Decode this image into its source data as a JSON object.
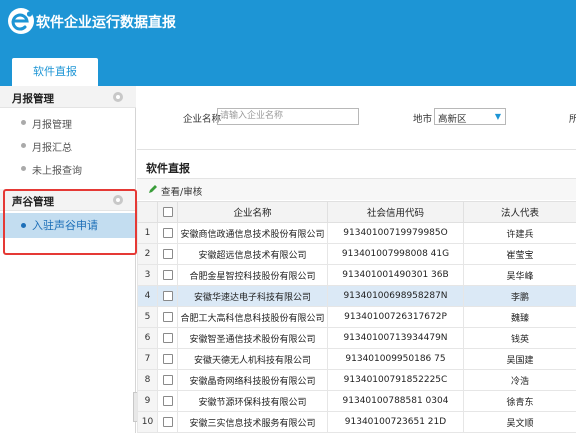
{
  "header": {
    "title": "软件企业运行数据直报",
    "logo_icon": "e-logo-icon"
  },
  "tabs": [
    {
      "label": "软件直报"
    }
  ],
  "sidebar": {
    "groups": [
      {
        "title": "月报管理",
        "items": [
          {
            "label": "月报管理"
          },
          {
            "label": "月报汇总"
          },
          {
            "label": "未上报查询"
          }
        ]
      },
      {
        "title": "声谷管理",
        "items": [
          {
            "label": "入驻声谷申请"
          }
        ]
      }
    ]
  },
  "search": {
    "company_label": "企业名称",
    "company_placeholder": "请输入企业名称",
    "region_label": "地市",
    "region_value": "高新区",
    "cut_label": "所"
  },
  "panel": {
    "title": "软件直报",
    "edit_label": "查看/审核"
  },
  "table": {
    "columns": [
      "企业名称",
      "社会信用代码",
      "法人代表"
    ],
    "rows": [
      {
        "num": "1",
        "name": "安徽商信政通信息技术股份有限公司",
        "code": "91340100719979985O",
        "rep": "许建兵"
      },
      {
        "num": "2",
        "name": "安徽超远信息技术有限公司",
        "code": "913401007998008 41G",
        "rep": "崔莹宝"
      },
      {
        "num": "3",
        "name": "合肥金星智控科技股份有限公司",
        "code": "913401001490301 36B",
        "rep": "吴华峰"
      },
      {
        "num": "4",
        "name": "安徽华速达电子科技有限公司",
        "code": "91340100698958287N",
        "rep": "李鹏"
      },
      {
        "num": "5",
        "name": "合肥工大高科信息科技股份有限公司",
        "code": "91340100726317672P",
        "rep": "魏臻"
      },
      {
        "num": "6",
        "name": "安徽智圣通信技术股份有限公司",
        "code": "91340100713934479N",
        "rep": "钱英"
      },
      {
        "num": "7",
        "name": "安徽天德无人机科技有限公司",
        "code": "913401009950186 75",
        "rep": "吴国建"
      },
      {
        "num": "8",
        "name": "安徽晶奇网络科技股份有限公司",
        "code": "91340100791852225C",
        "rep": "冷浩"
      },
      {
        "num": "9",
        "name": "安徽节源环保科技有限公司",
        "code": "91340100788581 0304",
        "rep": "徐青东"
      },
      {
        "num": "10",
        "name": "安徽三实信息技术服务有限公司",
        "code": "91340100723651 21D",
        "rep": "吴文顺"
      }
    ]
  },
  "colors": {
    "brand": "#1d95d5",
    "highlight": "#e53935",
    "selected_row": "#dbe9f6"
  }
}
